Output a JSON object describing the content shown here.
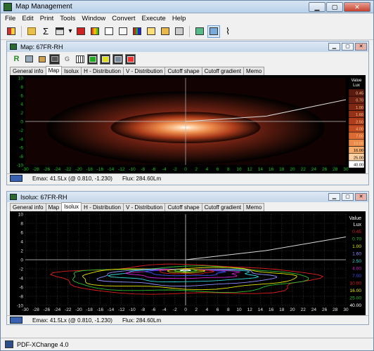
{
  "app": {
    "title": "Map Management"
  },
  "menu": [
    "File",
    "Edit",
    "Print",
    "Tools",
    "Window",
    "Convert",
    "Execute",
    "Help"
  ],
  "toolbar": {
    "sigma": "Σ",
    "gauge": "⌇"
  },
  "map_window": {
    "title": "Map: 67FR-RH",
    "tool_r": "R",
    "tool_g": "G"
  },
  "isolux_window": {
    "title": "Isolux: 67FR-RH"
  },
  "tabs": {
    "map": [
      "General info",
      "Map",
      "Isolux",
      "H - Distribution",
      "V - Distribution",
      "Cutoff shape",
      "Cutoff gradient",
      "Memo"
    ],
    "isolux": [
      "General info",
      "Map",
      "Isolux",
      "H - Distribution",
      "V - Distribution",
      "Cutoff shape",
      "Cutoff gradient",
      "Memo"
    ]
  },
  "map_status": {
    "emax": "Emax: 41.5Lx (@ 0.810, -1.230)",
    "flux": "Flux: 284.60Lm"
  },
  "isolux_status": {
    "emax": "Emax: 41.5Lx (@ 0.810, -1.230)",
    "flux": "Flux: 284.60Lm"
  },
  "app_status": {
    "text": "PDF-XChange 4.0"
  },
  "colors": {
    "map_axis_labels": "#21c521",
    "cutoff_line": "#d8d8d8"
  },
  "chart_data": [
    {
      "type": "heatmap",
      "title": "",
      "xlim": [
        -30,
        30
      ],
      "ylim": [
        -10,
        10
      ],
      "x_ticks": [
        -30,
        -28,
        -26,
        -24,
        -22,
        -20,
        -18,
        -16,
        -14,
        -12,
        -10,
        -8,
        -6,
        -4,
        -2,
        0,
        2,
        4,
        6,
        8,
        10,
        12,
        14,
        16,
        18,
        20,
        22,
        24,
        26,
        28,
        30
      ],
      "y_ticks": [
        10,
        8,
        6,
        4,
        2,
        0,
        -2,
        -4,
        -6,
        -8,
        -10
      ],
      "legend_title": [
        "Value",
        "Lux"
      ],
      "legend": [
        {
          "label": "0.45",
          "color": "#5a1a10"
        },
        {
          "label": "0.70",
          "color": "#6b2012"
        },
        {
          "label": "1.00",
          "color": "#7e2814"
        },
        {
          "label": "1.60",
          "color": "#963217"
        },
        {
          "label": "2.50",
          "color": "#ad3d1c"
        },
        {
          "label": "4.00",
          "color": "#c44c22"
        },
        {
          "label": "7.00",
          "color": "#db6b32"
        },
        {
          "label": "10.00",
          "color": "#eb8a4a"
        },
        {
          "label": "16.00",
          "color": "#f6ac6c"
        },
        {
          "label": "25.00",
          "color": "#fdd0a2"
        },
        {
          "label": "40.00",
          "color": "#ffffff"
        }
      ],
      "cutoff_line": [
        [
          0,
          0
        ],
        [
          15,
          1.2
        ],
        [
          30,
          5
        ]
      ]
    },
    {
      "type": "line",
      "title": "Isolux",
      "xlim": [
        -30,
        30
      ],
      "ylim": [
        -10,
        10
      ],
      "x_ticks": [
        -30,
        -28,
        -26,
        -24,
        -22,
        -20,
        -18,
        -16,
        -14,
        -12,
        -10,
        -8,
        -6,
        -4,
        -2,
        0,
        2,
        4,
        6,
        8,
        10,
        12,
        14,
        16,
        18,
        20,
        22,
        24,
        26,
        28,
        30
      ],
      "y_ticks": [
        10,
        8,
        6,
        4,
        2,
        0,
        -2,
        -4,
        -6,
        -8,
        -10
      ],
      "legend_title": [
        "Value",
        "Lux"
      ],
      "series": [
        {
          "name": "0.45",
          "color": "#e02020",
          "hw": 24,
          "top": -0.5,
          "bot": -7.6
        },
        {
          "name": "0.70",
          "color": "#2fc02f",
          "hw": 22,
          "top": -1.0,
          "bot": -7.0
        },
        {
          "name": "1.00",
          "color": "#e8e800",
          "hw": 20,
          "top": -1.3,
          "bot": -6.3
        },
        {
          "name": "1.60",
          "color": "#9090ff",
          "hw": 16,
          "top": -1.6,
          "bot": -5.6
        },
        {
          "name": "2.50",
          "color": "#30d8d8",
          "hw": 13,
          "top": -1.8,
          "bot": -4.8
        },
        {
          "name": "4.00",
          "color": "#d020d0",
          "hw": 10,
          "top": -1.9,
          "bot": -4.1
        },
        {
          "name": "7.00",
          "color": "#4050ff",
          "hw": 7,
          "top": -2.0,
          "bot": -3.5
        },
        {
          "name": "10.00",
          "color": "#e02020",
          "hw": 5,
          "top": -2.0,
          "bot": -3.1
        },
        {
          "name": "16.00",
          "color": "#e8e800",
          "hw": 3.5,
          "top": -2.1,
          "bot": -2.8
        },
        {
          "name": "25.00",
          "color": "#30c030",
          "hw": 2,
          "top": -2.1,
          "bot": -2.6
        },
        {
          "name": "40.00",
          "color": "#ffffff",
          "hw": 0.9,
          "top": -2.2,
          "bot": -2.45
        }
      ],
      "cutoff_line": [
        [
          0,
          0
        ],
        [
          15,
          2
        ],
        [
          30,
          5
        ]
      ]
    }
  ]
}
